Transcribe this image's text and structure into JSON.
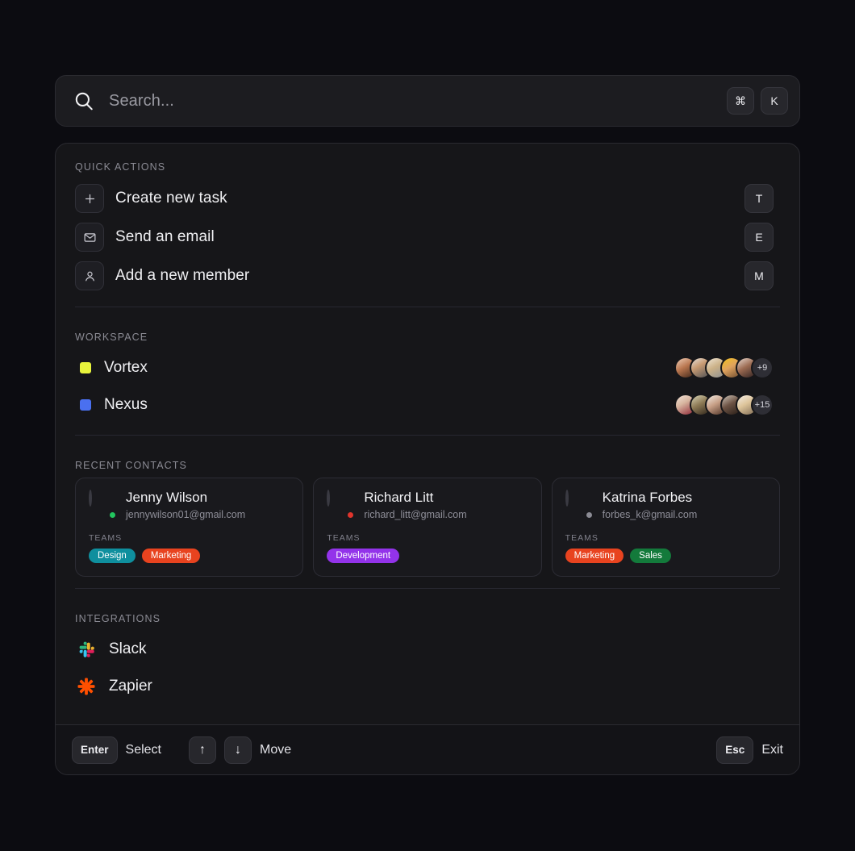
{
  "search": {
    "placeholder": "Search...",
    "value": "",
    "icon": "search-icon",
    "shortcut_keys": [
      "⌘",
      "K"
    ]
  },
  "sections": {
    "quick_actions": {
      "title": "QUICK ACTIONS",
      "items": [
        {
          "label": "Create new task",
          "icon": "plus-icon",
          "key": "T"
        },
        {
          "label": "Send an email",
          "icon": "envelope-icon",
          "key": "E"
        },
        {
          "label": "Add a new member",
          "icon": "user-icon",
          "key": "M"
        }
      ]
    },
    "workspace": {
      "title": "WORKSPACE",
      "items": [
        {
          "label": "Vortex",
          "color": "#e8f43c",
          "extra_count": "+9",
          "avatar_count": 5
        },
        {
          "label": "Nexus",
          "color": "#4a70f0",
          "extra_count": "+15",
          "avatar_count": 5
        }
      ]
    },
    "recent_contacts": {
      "title": "RECENT CONTACTS",
      "teams_label": "TEAMS",
      "items": [
        {
          "name": "Jenny Wilson",
          "email": "jennywilson01@gmail.com",
          "status": "online",
          "status_color": "#22c55e",
          "tags": [
            {
              "label": "Design",
              "color": "#0f8f9e"
            },
            {
              "label": "Marketing",
              "color": "#e8431f"
            }
          ]
        },
        {
          "name": "Richard Litt",
          "email": "richard_litt@gmail.com",
          "status": "busy",
          "status_color": "#e0342c",
          "tags": [
            {
              "label": "Development",
              "color": "#9333ea"
            }
          ]
        },
        {
          "name": "Katrina Forbes",
          "email": "forbes_k@gmail.com",
          "status": "offline",
          "status_color": "#8b8b94",
          "tags": [
            {
              "label": "Marketing",
              "color": "#e8431f"
            },
            {
              "label": "Sales",
              "color": "#137a3b"
            }
          ]
        }
      ]
    },
    "integrations": {
      "title": "INTEGRATIONS",
      "items": [
        {
          "label": "Slack",
          "icon": "slack-logo-icon"
        },
        {
          "label": "Zapier",
          "icon": "zapier-logo-icon"
        }
      ]
    }
  },
  "footer": {
    "enter_key": "Enter",
    "enter_action": "Select",
    "up_key": "↑",
    "down_key": "↓",
    "move_action": "Move",
    "esc_key": "Esc",
    "esc_action": "Exit"
  }
}
